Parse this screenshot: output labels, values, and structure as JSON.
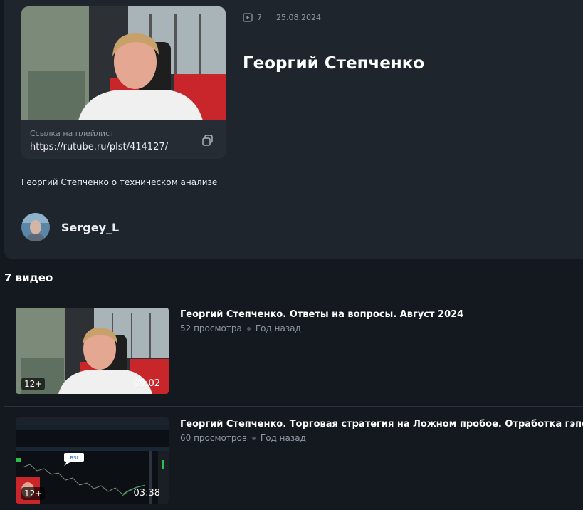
{
  "playlist": {
    "video_count": "7",
    "date": "25.08.2024",
    "title": "Георгий Степченко",
    "link_caption": "Ссылка на плейлист",
    "link_url": "https://rutube.ru/plst/414127/",
    "description": "Георгий Степченко о техническом анализе",
    "author": "Sergey_L"
  },
  "videos_heading": "7 видео",
  "videos": [
    {
      "title": "Георгий Степченко. Ответы на вопросы. Август 2024",
      "views": "52 просмотра",
      "age": "Год назад",
      "age_rating": "12+",
      "duration": "09:02"
    },
    {
      "title": "Георгий Степченко. Торговая стратегия на Ложном пробое. Отработка гэпов",
      "views": "60 просмотров",
      "age": "Год назад",
      "age_rating": "12+",
      "duration": "03:38",
      "chart_label": "RSI"
    }
  ],
  "icons": {
    "meta": "video-count-icon",
    "copy": "copy-icon"
  },
  "colors": {
    "page_bg": "#14191f",
    "card_bg": "#1f252d",
    "muted_text": "#8c97a3",
    "divider": "#2b323b"
  }
}
